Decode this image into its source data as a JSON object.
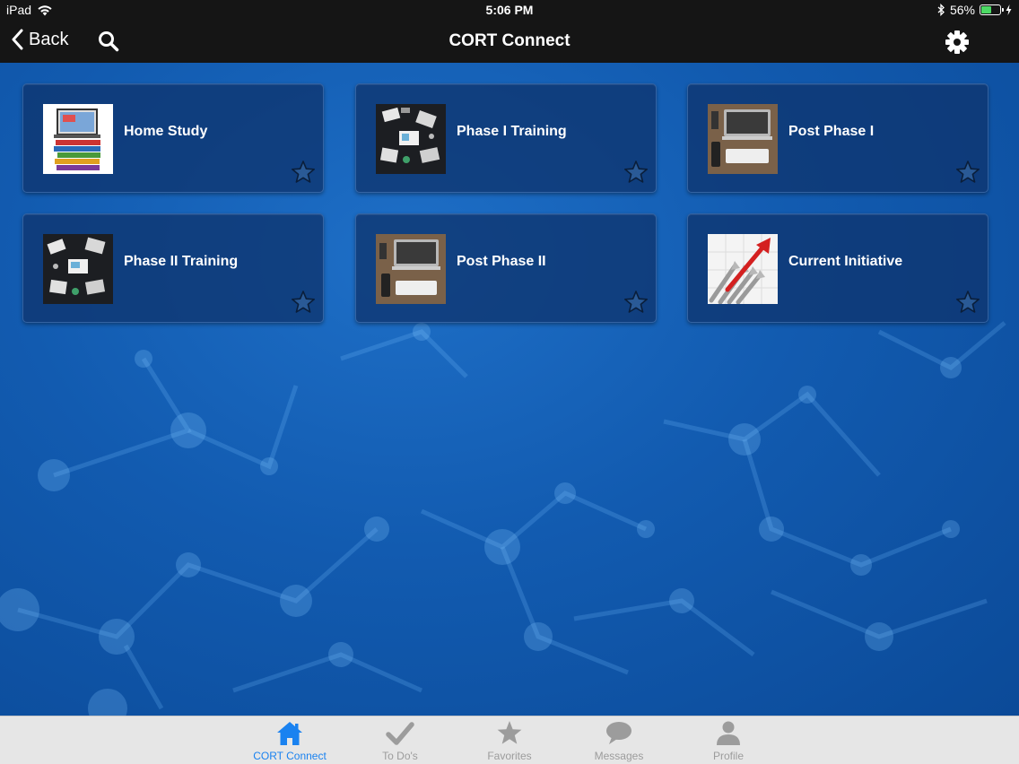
{
  "status_bar": {
    "device": "iPad",
    "time": "5:06 PM",
    "battery": "56%",
    "battery_level": 0.56
  },
  "nav": {
    "back_label": "Back",
    "title": "CORT Connect"
  },
  "tiles": [
    {
      "label": "Home Study"
    },
    {
      "label": "Phase I Training"
    },
    {
      "label": "Post Phase I"
    },
    {
      "label": "Phase II Training"
    },
    {
      "label": "Post Phase II"
    },
    {
      "label": "Current Initiative"
    }
  ],
  "tabs": [
    {
      "label": "CORT Connect",
      "icon": "home-icon",
      "active": true
    },
    {
      "label": "To Do's",
      "icon": "checkmark-icon",
      "active": false
    },
    {
      "label": "Favorites",
      "icon": "star-icon",
      "active": false
    },
    {
      "label": "Messages",
      "icon": "chat-bubble-icon",
      "active": false
    },
    {
      "label": "Profile",
      "icon": "person-icon",
      "active": false
    }
  ],
  "colors": {
    "bar_bg": "#151515",
    "content_blue": "#125bb0",
    "tile_bg": "#0e346e",
    "tab_active": "#1a82f0",
    "tab_inactive": "#9c9c9c",
    "battery_green": "#4cd964"
  }
}
